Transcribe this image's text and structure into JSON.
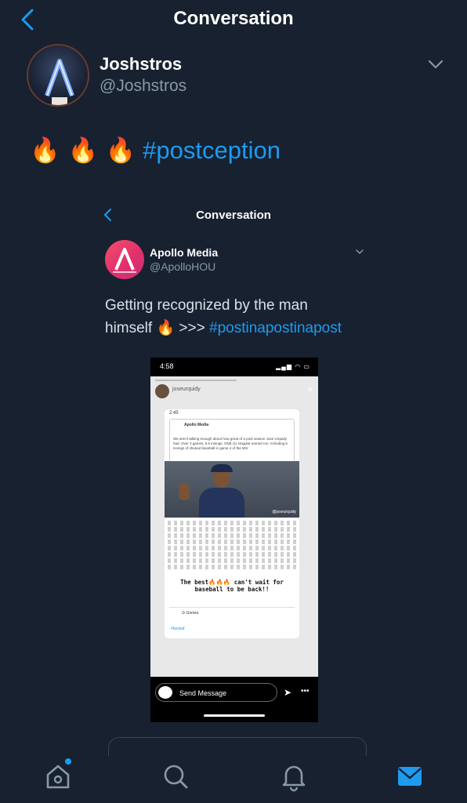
{
  "nav": {
    "title": "Conversation"
  },
  "tweet": {
    "name": "Joshstros",
    "handle": "@Joshstros",
    "emoji": "🔥 🔥 🔥",
    "hashtag": "#postception"
  },
  "embedded": {
    "title": "Conversation",
    "name": "Apollo Media",
    "handle": "@ApolloHOU",
    "text_line1": "Getting recognized by the man",
    "text_line2_start": "himself",
    "text_line2_mid": ">>>",
    "hashtag": "#postinapostinapost",
    "phone": {
      "time": "4:58",
      "status": "▂▄▆ ◠ ▭",
      "story_user": "joseurquidy",
      "card_time": "2:45",
      "post_name": "Apollo Media",
      "post_text": "We aren't talking enough about how great of a post season Jose Urquidy had. Over 3 games, 8.6 innings, ONE (1) singular earned run. Including 5 innings of shutout baseball in game 4 of the WS.",
      "photo_tag": "@joseurquidy",
      "caption": "The best🔥🔥🔥 can't wait for baseball to be back!!",
      "reply_name": "Jr Gomez",
      "reply_tag": "#factsaf",
      "send_message": "Send Message"
    }
  },
  "colors": {
    "background": "#172130",
    "accent": "#1d9bf0",
    "secondary": "#8899a6"
  },
  "tabs": [
    "home-icon",
    "search-icon",
    "bell-icon",
    "mail-icon"
  ]
}
